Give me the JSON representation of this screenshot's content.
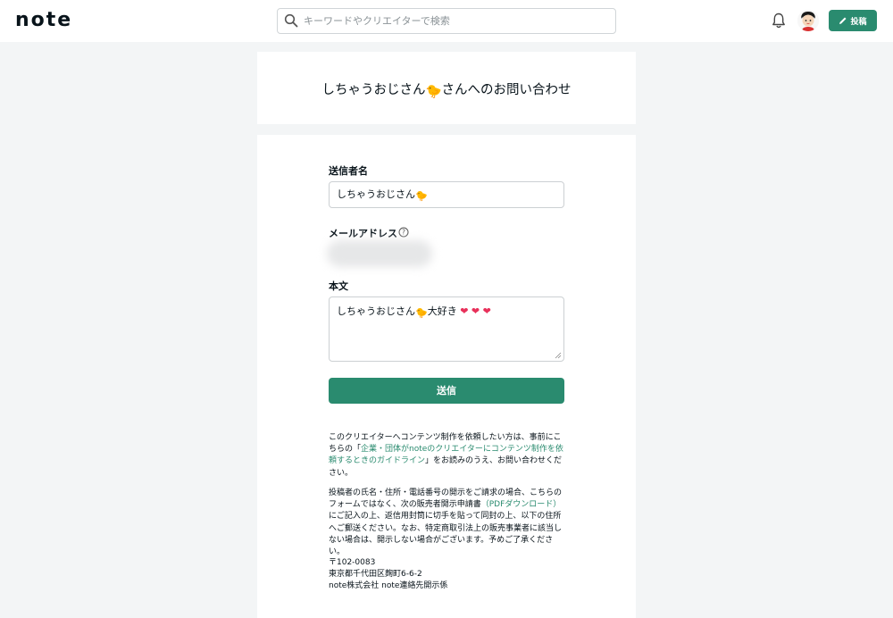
{
  "header": {
    "logo": "note",
    "search_placeholder": "キーワードやクリエイターで検索",
    "post_label": "投稿"
  },
  "title": {
    "name": "しちゃうおじさん",
    "emoji": "🐤",
    "suffix": "さんへのお問い合わせ"
  },
  "form": {
    "sender_label": "送信者名",
    "sender_value": "しちゃうおじさん",
    "sender_emoji": "🐤",
    "email_label": "メールアドレス",
    "body_label": "本文",
    "body_text": "しちゃうおじさん",
    "body_emoji": "🐤",
    "body_after": "大好き",
    "hearts": "❤ ❤ ❤",
    "submit_label": "送信"
  },
  "notice": {
    "p1_before": "このクリエイターへコンテンツ制作を依頼したい方は、事前にこちらの「",
    "p1_link": "企業・団体がnoteのクリエイターにコンテンツ制作を依頼するときのガイドライン",
    "p1_after": "」をお読みのうえ、お問い合わせください。",
    "p2_before": "投稿者の氏名・住所・電話番号の開示をご請求の場合、こちらのフォームではなく、次の販売者開示申請書",
    "p2_link": "（PDFダウンロード）",
    "p2_after": "にご記入の上、返信用封筒に切手を貼って同封の上、以下の住所へご郵送ください。なお、特定商取引法上の販売事業者に該当しない場合は、開示しない場合がございます。予めご了承ください。",
    "postal": "〒102-0083",
    "address": "東京都千代田区麹町6-6-2",
    "company": "note株式会社 note連絡先開示係"
  },
  "colors": {
    "accent": "#2a8b6f",
    "heart": "#e8305a",
    "background": "#f3f5f6"
  }
}
